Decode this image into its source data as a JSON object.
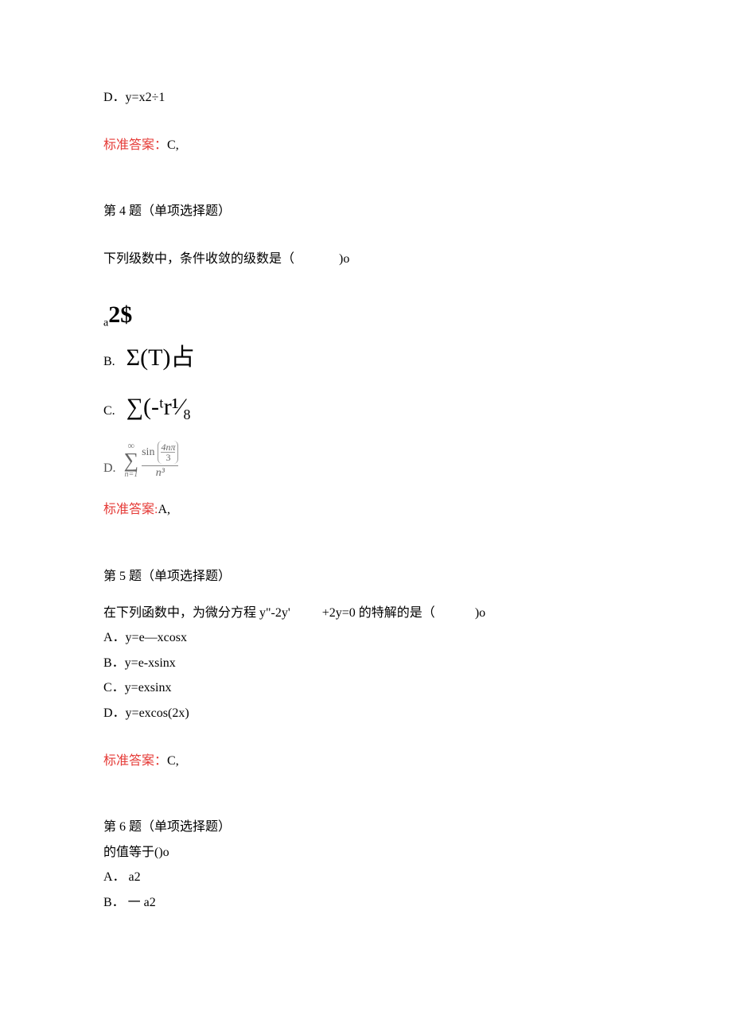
{
  "q3_remainder": {
    "option_d": "D．y=x2÷1",
    "answer_label": "标准答案：",
    "answer_value": "C,"
  },
  "q4": {
    "heading": "第 4 题（单项选择题）",
    "stem_part1": "下列级数中，条件收敛的级数是（",
    "stem_part2": ")o",
    "options": {
      "a_sub": "a",
      "a_big": "2$",
      "b_prefix": "B.",
      "b_math": "Σ(T)占",
      "c_prefix": "C.",
      "c_math": "∑(-ᵗr¹⁄₈",
      "d_prefix": "D.",
      "d_sigma_top": "∞",
      "d_sigma": "∑",
      "d_sigma_bottom": "n=1",
      "d_sin": "sin",
      "d_inner_num": "4nπ",
      "d_inner_den": "3",
      "d_den": "n³"
    },
    "answer_label": "标准答案:",
    "answer_value": "A,"
  },
  "q5": {
    "heading": "第 5 题（单项选择题）",
    "stem_part1": " 在下列函数中，为微分方程 y\"-2y'",
    "stem_part2": "+2y=0 的特解的是（",
    "stem_part3": ")o",
    "options": {
      "a": "A．y=e—xcosx",
      "b": "B．y=e-xsinx",
      "c": "C．y=exsinx",
      "d": "D．y=excos(2x)"
    },
    "answer_label": "标准答案：",
    "answer_value": "C,"
  },
  "q6": {
    "heading": "第 6 题（单项选择题）",
    "stem": "的值等于()o",
    "options": {
      "a": "A．  a2",
      "b": "B．  一 a2"
    }
  }
}
